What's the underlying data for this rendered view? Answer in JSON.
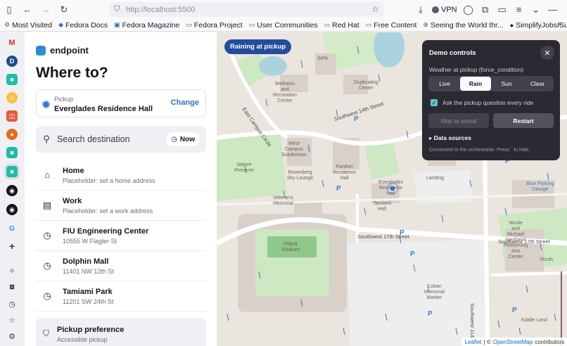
{
  "browser": {
    "url": "http://localhost:5500",
    "vpn_label": "VPN",
    "bookmarks": [
      {
        "icon": "gear-icon",
        "label": "Most Visited"
      },
      {
        "icon": "docs-icon",
        "label": "Fedora Docs"
      },
      {
        "icon": "magazine-icon",
        "label": "Fedora Magazine"
      },
      {
        "icon": "folder-icon",
        "label": "Fedora Project"
      },
      {
        "icon": "folder-icon",
        "label": "User Communities"
      },
      {
        "icon": "folder-icon",
        "label": "Red Hat"
      },
      {
        "icon": "folder-icon",
        "label": "Free Content"
      },
      {
        "icon": "globe-icon",
        "label": "Seeing the World thr..."
      },
      {
        "icon": "github-icon",
        "label": "SimplifyJobs/Summer..."
      }
    ]
  },
  "app": {
    "brand": "endpoint",
    "heading": "Where to?",
    "pickup": {
      "label": "Pickup",
      "value": "Everglades Residence Hall",
      "change": "Change"
    },
    "search": {
      "placeholder": "Search destination",
      "now_label": "Now"
    },
    "destinations": [
      {
        "icon": "home-icon",
        "title": "Home",
        "subtitle": "Placeholder: set a home address"
      },
      {
        "icon": "briefcase-icon",
        "title": "Work",
        "subtitle": "Placeholder: set a work address"
      },
      {
        "icon": "clock-icon",
        "title": "FIU Engineering Center",
        "subtitle": "10555 W Flagler St"
      },
      {
        "icon": "clock-icon",
        "title": "Dolphin Mall",
        "subtitle": "11401 NW 12th St"
      },
      {
        "icon": "clock-icon",
        "title": "Tamiami Park",
        "subtitle": "11201 SW 24th St"
      }
    ],
    "preference": {
      "title": "Pickup preference",
      "subtitle": "Accessible pickup"
    }
  },
  "map": {
    "badge": "Raining at pickup",
    "streets": {
      "east_campus_circle": "East Campus Circle",
      "sw_14th": "Southwest 14th Street",
      "sw_17th": "Southwest 17th Street",
      "sw_17th_right": "Southwest 17th Street",
      "sw_114th": "Southwest 114th"
    },
    "places": {
      "wellness": "Wellness\nand\nRecreation\nCenter",
      "duplicating": "Duplicating\nCenter",
      "sipa": "SIPA",
      "west_campus": "West\nCampus\nSubdivision",
      "nature_preserve": "Nature\nPreserve",
      "rosenberg": "Rosenberg\nSky Lounge",
      "panther": "Panther\nResidence\nHall",
      "everglades": "Everglades\nResidence\nHall",
      "veterans": "Veteran's\nMemorial",
      "pitbull": "Pitbull\nStadium",
      "tamiami": "Tamiami\nHall",
      "nicole": "Nicole\nand\nMichael\nWertheim\nPerforming\nArts\nCenter",
      "coban": "Coban\nMemorial\nMarker",
      "blue_parking": "Blue Parking\nGarage",
      "kiddie": "Kiddie Land",
      "landing": "Landing",
      "ricoh": "Ricoh"
    },
    "attribution": {
      "leaflet": "Leaflet",
      "separator": "| ©",
      "osm": "OpenStreetMap",
      "contributors": "contributors"
    },
    "colors": {
      "land": "#eae6df",
      "grass": "#cde8c2",
      "building": "#d9d0c9",
      "water": "#aad3df",
      "parking": "#eeeeee",
      "rain": "#3d5fa8"
    }
  },
  "demo": {
    "title": "Demo controls",
    "weather_label": "Weather at pickup (force_condition)",
    "options": [
      "Live",
      "Rain",
      "Sun",
      "Clear"
    ],
    "selected": "Rain",
    "checkbox_label": "Ask the pickup question every ride",
    "skip_label": "Skip to arrival",
    "restart_label": "Restart",
    "data_sources": "▸ Data sources",
    "footer": "Connected to the orchestrator. Press ` to hide."
  }
}
